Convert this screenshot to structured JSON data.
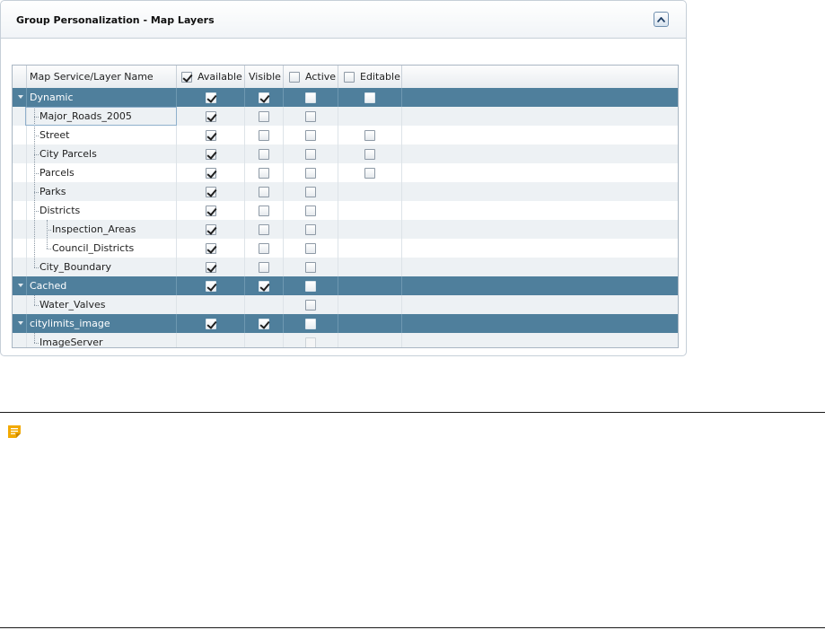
{
  "panel": {
    "title": "Group Personalization - Map Layers"
  },
  "grid": {
    "headers": {
      "name": "Map Service/Layer Name",
      "available": "Available",
      "visible": "Visible",
      "active": "Active",
      "editable": "Editable"
    },
    "header_checks": {
      "available": true,
      "active": false,
      "editable": false
    },
    "rows": [
      {
        "name": "Dynamic",
        "type": "group",
        "available": true,
        "visible": true,
        "active": false,
        "editable": false
      },
      {
        "name": "Major_Roads_2005",
        "type": "layer",
        "available": true,
        "visible": false,
        "active": false,
        "editable": null
      },
      {
        "name": "Street",
        "type": "layer",
        "available": true,
        "visible": false,
        "active": false,
        "editable": false
      },
      {
        "name": "City Parcels",
        "type": "layer",
        "available": true,
        "visible": false,
        "active": false,
        "editable": false
      },
      {
        "name": "Parcels",
        "type": "layer",
        "available": true,
        "visible": false,
        "active": false,
        "editable": false
      },
      {
        "name": "Parks",
        "type": "layer",
        "available": true,
        "visible": false,
        "active": false,
        "editable": null
      },
      {
        "name": "Districts",
        "type": "layer",
        "available": true,
        "visible": false,
        "active": false,
        "editable": null
      },
      {
        "name": "Inspection_Areas",
        "type": "sublayer",
        "available": true,
        "visible": false,
        "active": false,
        "editable": null
      },
      {
        "name": "Council_Districts",
        "type": "sublayer",
        "available": true,
        "visible": false,
        "active": false,
        "editable": null
      },
      {
        "name": "City_Boundary",
        "type": "layer",
        "available": true,
        "visible": false,
        "active": false,
        "editable": null
      },
      {
        "name": "Cached",
        "type": "group",
        "available": true,
        "visible": true,
        "active": false,
        "editable": null
      },
      {
        "name": "Water_Valves",
        "type": "layer",
        "available": null,
        "visible": null,
        "active": false,
        "editable": null
      },
      {
        "name": "citylimits_image",
        "type": "group",
        "available": true,
        "visible": true,
        "active": false,
        "editable": null
      },
      {
        "name": "ImageServer",
        "type": "layer",
        "available": null,
        "visible": null,
        "active": "disabled",
        "editable": null
      }
    ]
  },
  "icons": {
    "collapse": "chevron-up-icon",
    "note": "note-icon"
  },
  "colors": {
    "group_row": "#4f7f9c",
    "alt_row": "#edf1f4",
    "note_icon": "#f2a900"
  }
}
